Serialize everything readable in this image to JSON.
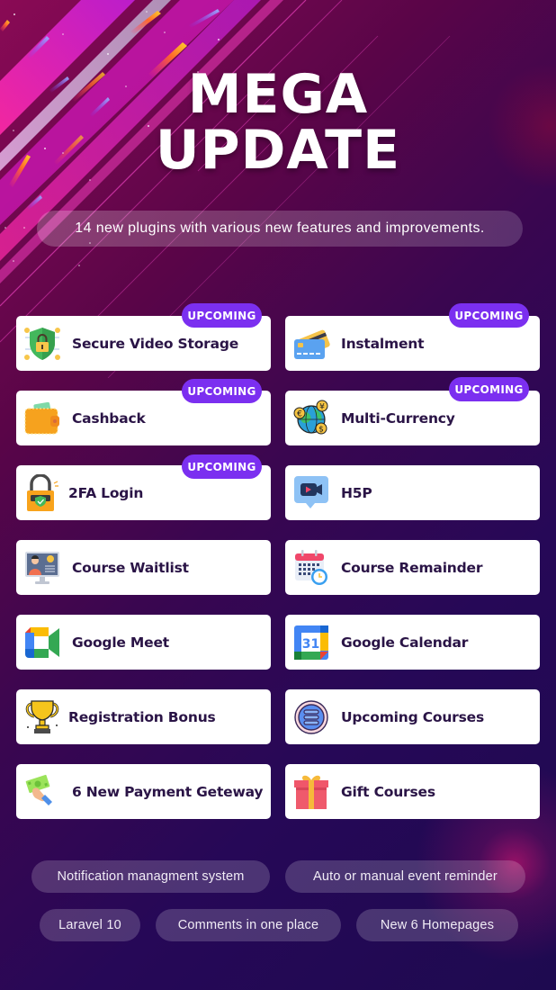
{
  "header": {
    "title_line1": "MEGA",
    "title_line2": "UPDATE",
    "subtitle": "14 new plugins with various new features and improvements."
  },
  "badge_label": "UPCOMING",
  "accent_color": "#7b2ff0",
  "features": [
    {
      "label": "Secure Video Storage",
      "icon": "shield-lock-icon",
      "upcoming": true
    },
    {
      "label": "Instalment",
      "icon": "credit-card-icon",
      "upcoming": true
    },
    {
      "label": "Cashback",
      "icon": "wallet-icon",
      "upcoming": true
    },
    {
      "label": "Multi-Currency",
      "icon": "globe-currency-icon",
      "upcoming": true
    },
    {
      "label": "2FA Login",
      "icon": "padlock-shield-icon",
      "upcoming": true
    },
    {
      "label": "H5P",
      "icon": "video-camera-bubble-icon",
      "upcoming": false
    },
    {
      "label": "Course Waitlist",
      "icon": "monitor-user-icon",
      "upcoming": false
    },
    {
      "label": "Course Remainder",
      "icon": "calendar-clock-icon",
      "upcoming": false
    },
    {
      "label": "Google Meet",
      "icon": "google-meet-icon",
      "upcoming": false
    },
    {
      "label": "Google Calendar",
      "icon": "google-calendar-icon",
      "upcoming": false
    },
    {
      "label": "Registration Bonus",
      "icon": "trophy-icon",
      "upcoming": false
    },
    {
      "label": "Upcoming Courses",
      "icon": "list-circle-icon",
      "upcoming": false
    },
    {
      "label": "6 New Payment Geteway",
      "icon": "hand-money-icon",
      "upcoming": false
    },
    {
      "label": "Gift Courses",
      "icon": "gift-box-icon",
      "upcoming": false
    }
  ],
  "google_calendar_day": "31",
  "extras": [
    "Notification managment system",
    "Auto or manual event reminder",
    "Laravel 10",
    "Comments in one place",
    "New 6 Homepages"
  ]
}
